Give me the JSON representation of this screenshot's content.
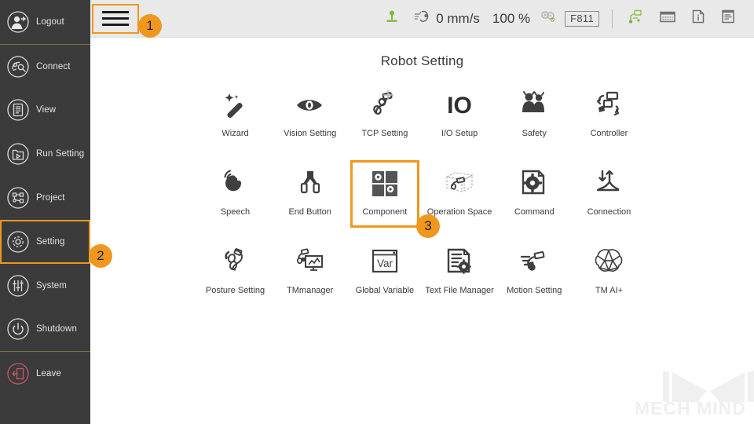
{
  "app": {
    "accent_color": "#f0971f",
    "sidebar_bg": "#3b3b3b",
    "header_bg": "#e9e9e9",
    "divider_color": "#6f7a45",
    "leave_color": "#c9566a"
  },
  "sidebar": {
    "items": [
      {
        "label": "Logout",
        "icon": "user-logout-icon",
        "selected": false,
        "sep_after": true
      },
      {
        "label": "Connect",
        "icon": "connect-icon",
        "selected": false,
        "sep_after": false
      },
      {
        "label": "View",
        "icon": "view-list-icon",
        "selected": false,
        "sep_after": false
      },
      {
        "label": "Run Setting",
        "icon": "folder-run-icon",
        "selected": false,
        "sep_after": false
      },
      {
        "label": "Project",
        "icon": "project-nodes-icon",
        "selected": false,
        "sep_after": false
      },
      {
        "label": "Setting",
        "icon": "gear-icon",
        "selected": true,
        "sep_after": false
      },
      {
        "label": "System",
        "icon": "sliders-icon",
        "selected": false,
        "sep_after": false
      },
      {
        "label": "Shutdown",
        "icon": "power-icon",
        "selected": false,
        "sep_after": true
      },
      {
        "label": "Leave",
        "icon": "exit-door-icon",
        "selected": false,
        "sep_after": false
      }
    ]
  },
  "header": {
    "menu_button": "hamburger-menu-icon",
    "robot_base_icon": "robot-base-icon",
    "speed_icon": "robot-speed-icon",
    "speed_value": "0 mm/s",
    "percent_value": "100 %",
    "zoom_icon": "zoom-in-out-icon",
    "function_code": "F811",
    "robot_link_icon": "robot-link-icon",
    "keyboard_icon": "keyboard-icon",
    "info_icon": "info-icon",
    "log_icon": "log-document-icon"
  },
  "main": {
    "title": "Robot Setting",
    "rows": [
      [
        {
          "label": "Wizard",
          "icon": "wizard-wand-icon",
          "selected": false
        },
        {
          "label": "Vision Setting",
          "icon": "eye-icon",
          "selected": false
        },
        {
          "label": "TCP Setting",
          "icon": "tcp-robot-arm-icon",
          "selected": false
        },
        {
          "label": "I/O Setup",
          "icon": "io-icon",
          "selected": false
        },
        {
          "label": "Safety",
          "icon": "safety-people-icon",
          "selected": false
        },
        {
          "label": "Controller",
          "icon": "controller-icon",
          "selected": false
        }
      ],
      [
        {
          "label": "Speech",
          "icon": "speech-icon",
          "selected": false
        },
        {
          "label": "End Button",
          "icon": "end-button-icon",
          "selected": false
        },
        {
          "label": "Component",
          "icon": "component-puzzle-icon",
          "selected": true
        },
        {
          "label": "Operation Space",
          "icon": "operation-space-icon",
          "selected": false
        },
        {
          "label": "Command",
          "icon": "command-gear-doc-icon",
          "selected": false
        },
        {
          "label": "Connection",
          "icon": "connection-chart-icon",
          "selected": false
        }
      ],
      [
        {
          "label": "Posture Setting",
          "icon": "posture-setting-icon",
          "selected": false
        },
        {
          "label": "TMmanager",
          "icon": "tmmanager-icon",
          "selected": false
        },
        {
          "label": "Global Variable",
          "icon": "global-variable-icon",
          "selected": false
        },
        {
          "label": "Text File Manager",
          "icon": "text-file-manager-icon",
          "selected": false
        },
        {
          "label": "Motion Setting",
          "icon": "motion-setting-icon",
          "selected": false
        },
        {
          "label": "TM AI+",
          "icon": "tm-ai-brain-icon",
          "selected": false
        }
      ]
    ]
  },
  "annotations": {
    "badges": [
      {
        "number": "1",
        "target": "hamburger-menu-button"
      },
      {
        "number": "2",
        "target": "sidebar-item-setting"
      },
      {
        "number": "3",
        "target": "tile-component"
      }
    ]
  },
  "watermark": {
    "text": "MECH MIND",
    "logo": "mech-mind-logo"
  },
  "icon_glyphs": {
    "var_text": "Var",
    "io_text": "IO"
  }
}
